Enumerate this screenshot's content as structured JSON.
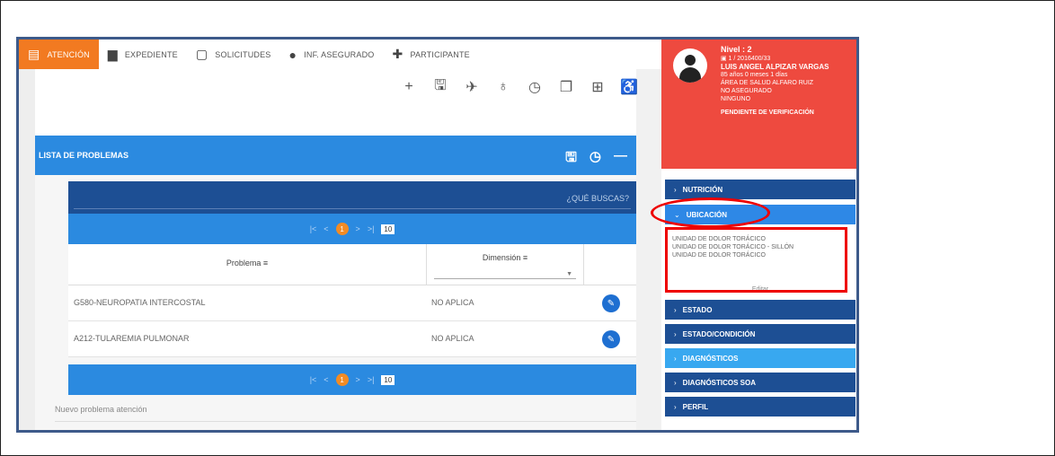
{
  "tabs": [
    {
      "label": "ATENCIÓN",
      "icon": "attention-icon"
    },
    {
      "label": "EXPEDIENTE",
      "icon": "folder-icon"
    },
    {
      "label": "SOLICITUDES",
      "icon": "monitor-icon"
    },
    {
      "label": "INF. ASEGURADO",
      "icon": "person-icon"
    },
    {
      "label": "PARTICIPANTE",
      "icon": "group-add-icon"
    }
  ],
  "toolbar": [
    "add-icon",
    "save-icon",
    "plane-icon",
    "stethoscope-icon",
    "history-icon",
    "copy-icon",
    "add-box-icon",
    "accessibility-icon"
  ],
  "problems_panel": {
    "title": "LISTA DE PROBLEMAS",
    "search_placeholder": "¿QUÉ BUSCAS?",
    "pager": {
      "first": "|<",
      "prev": "<",
      "page": "1",
      "next": ">",
      "last": ">|",
      "page_size": "10"
    },
    "columns": {
      "problem": "Problema",
      "dimension": "Dimensión"
    },
    "rows": [
      {
        "problem": "G580-NEUROPATIA INTERCOSTAL",
        "dimension": "NO APLICA"
      },
      {
        "problem": "A212-TULAREMIA PULMONAR",
        "dimension": "NO APLICA"
      }
    ],
    "new_problem_label": "Nuevo problema atención"
  },
  "patient": {
    "level": "Nivel : 2",
    "id": "▣ 1 / 2016400/33",
    "name": "LUIS ANGEL ALPIZAR VARGAS",
    "age": "85 años 0 meses 1 días",
    "area": "ÁREA DE SALUD ALFARO RUIZ",
    "extra1": "NO ASEGURADO",
    "extra2": "NINGUNO",
    "status": "PENDIENTE DE VERIFICACIÓN"
  },
  "accordion": [
    {
      "label": "NUTRICIÓN",
      "state": "closed"
    },
    {
      "label": "UBICACIÓN",
      "state": "open"
    },
    {
      "label": "ESTADO",
      "state": "closed"
    },
    {
      "label": "ESTADO/CONDICIÓN",
      "state": "closed"
    },
    {
      "label": "DIAGNÓSTICOS",
      "state": "highlight"
    },
    {
      "label": "DIAGNÓSTICOS SOA",
      "state": "closed"
    },
    {
      "label": "PERFIL",
      "state": "closed"
    }
  ],
  "location": {
    "lines": [
      "UNIDAD DE DOLOR TORÁCICO",
      "UNIDAD DE DOLOR TORÁCICO - SILLÓN",
      "UNIDAD DE DOLOR TORÁCICO"
    ],
    "edit_label": "Editar"
  },
  "colors": {
    "accent": "#f27a21",
    "primary": "#2b8ae0",
    "dark": "#1d4f94",
    "patient": "#ee4a3f",
    "annotation": "#e00000"
  }
}
